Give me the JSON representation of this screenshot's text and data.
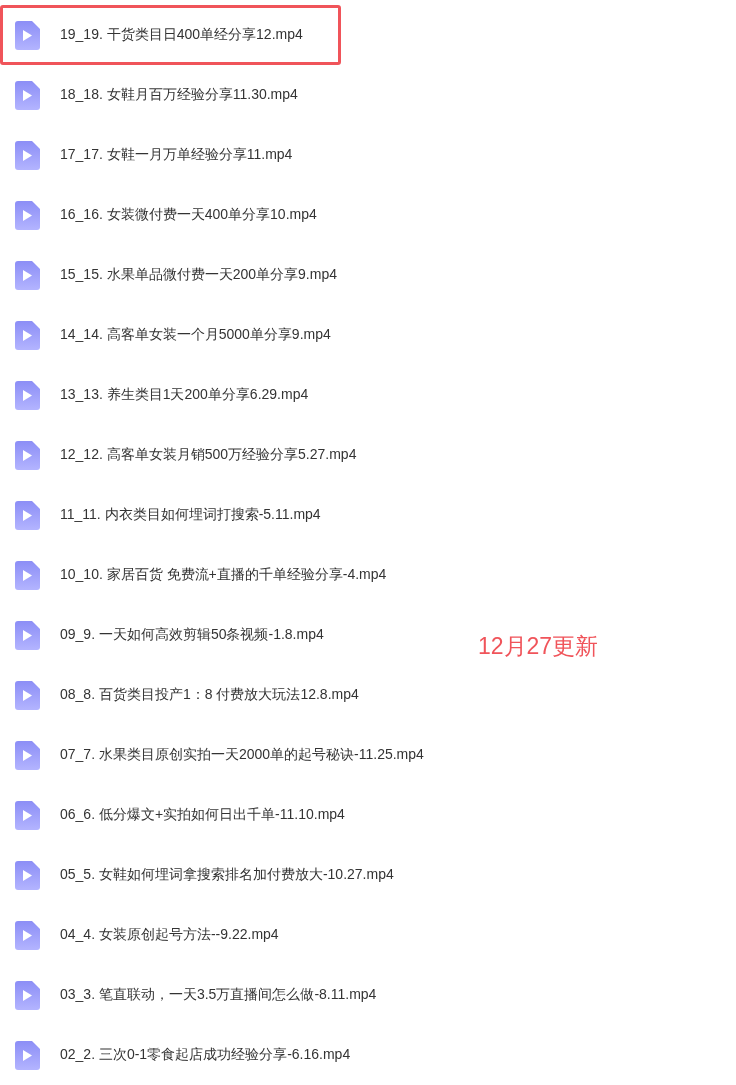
{
  "files": [
    {
      "name": "19_19. 干货类目日400单经分享12.mp4",
      "highlighted": true
    },
    {
      "name": "18_18. 女鞋月百万经验分享11.30.mp4",
      "highlighted": false
    },
    {
      "name": "17_17. 女鞋一月万单经验分享11.mp4",
      "highlighted": false
    },
    {
      "name": "16_16. 女装微付费一天400单分享10.mp4",
      "highlighted": false
    },
    {
      "name": "15_15. 水果单品微付费一天200单分享9.mp4",
      "highlighted": false
    },
    {
      "name": "14_14. 高客单女装一个月5000单分享9.mp4",
      "highlighted": false
    },
    {
      "name": "13_13. 养生类目1天200单分享6.29.mp4",
      "highlighted": false
    },
    {
      "name": "12_12. 高客单女装月销500万经验分享5.27.mp4",
      "highlighted": false
    },
    {
      "name": "11_11. 内衣类目如何埋词打搜索-5.11.mp4",
      "highlighted": false
    },
    {
      "name": "10_10. 家居百货 免费流+直播的千单经验分享-4.mp4",
      "highlighted": false
    },
    {
      "name": "09_9. 一天如何高效剪辑50条视频-1.8.mp4",
      "highlighted": false
    },
    {
      "name": "08_8. 百货类目投产1：8 付费放大玩法12.8.mp4",
      "highlighted": false
    },
    {
      "name": "07_7. 水果类目原创实拍一天2000单的起号秘诀-11.25.mp4",
      "highlighted": false
    },
    {
      "name": "06_6. 低分爆文+实拍如何日出千单-11.10.mp4",
      "highlighted": false
    },
    {
      "name": "05_5. 女鞋如何埋词拿搜索排名加付费放大-10.27.mp4",
      "highlighted": false
    },
    {
      "name": "04_4. 女装原创起号方法--9.22.mp4",
      "highlighted": false
    },
    {
      "name": "03_3. 笔直联动，一天3.5万直播间怎么做-8.11.mp4",
      "highlighted": false
    },
    {
      "name": "02_2. 三次0-1零食起店成功经验分享-6.16.mp4",
      "highlighted": false
    }
  ],
  "note": "12月27更新"
}
